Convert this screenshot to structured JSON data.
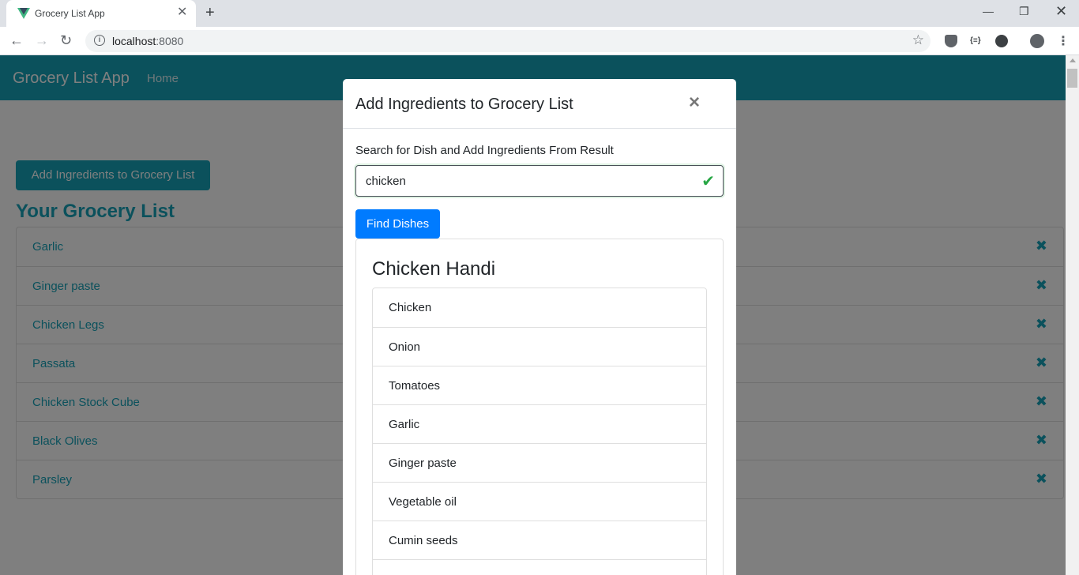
{
  "browser": {
    "tab_title": "Grocery List App",
    "url_host": "localhost",
    "url_port": ":8080",
    "icons": [
      "vue-favicon-icon",
      "close-icon",
      "plus-icon",
      "minimize-icon",
      "restore-icon",
      "close-window-icon",
      "back-icon",
      "forward-icon",
      "reload-icon",
      "info-icon",
      "star-icon",
      "extension-icon",
      "profile-icon",
      "more-icon"
    ]
  },
  "navbar": {
    "brand": "Grocery List App",
    "home": "Home"
  },
  "main": {
    "add_button": "Add Ingredients to Grocery List",
    "list_title": "Your Grocery List",
    "items": [
      "Garlic",
      "Ginger paste",
      "Chicken Legs",
      "Passata",
      "Chicken Stock Cube",
      "Black Olives",
      "Parsley"
    ],
    "remove_symbol": "✖"
  },
  "modal": {
    "title": "Add Ingredients to Grocery List",
    "close_symbol": "×",
    "search_label": "Search for Dish and Add Ingredients From Result",
    "search_value": "chicken",
    "valid_symbol": "✔",
    "find_button": "Find Dishes",
    "dish": "Chicken Handi",
    "ingredients": [
      "Chicken",
      "Onion",
      "Tomatoes",
      "Garlic",
      "Ginger paste",
      "Vegetable oil",
      "Cumin seeds"
    ]
  },
  "colors": {
    "navbar": "#17a2b8",
    "primary": "#007bff",
    "valid": "#28a745"
  }
}
